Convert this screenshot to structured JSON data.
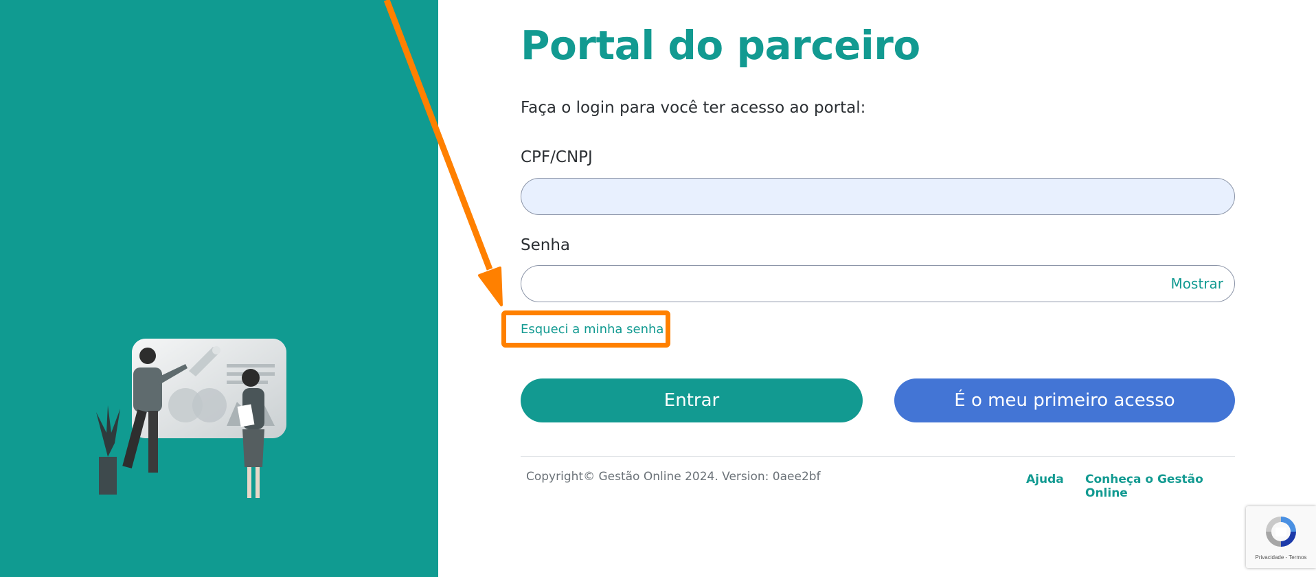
{
  "page": {
    "title": "Portal do parceiro",
    "subtitle": "Faça o login para você ter acesso ao portal:"
  },
  "form": {
    "cpf_label": "CPF/CNPJ",
    "cpf_value": "",
    "senha_label": "Senha",
    "senha_value": "",
    "show_password": "Mostrar",
    "forgot_password": "Esqueci a minha senha",
    "login_button": "Entrar",
    "first_access_button": "É o meu primeiro acesso"
  },
  "footer": {
    "copyright": "Copyright© Gestão Online 2024. Version: 0aee2bf",
    "help_link": "Ajuda",
    "know_link": "Conheça o Gestão Online"
  },
  "recaptcha": {
    "terms": "Privacidade - Termos",
    "icon": "recaptcha-icon"
  },
  "colors": {
    "brand_teal": "#129a91",
    "left_panel": "#109b91",
    "primary_blue": "#4375d5",
    "annotation_orange": "#ff8000"
  }
}
